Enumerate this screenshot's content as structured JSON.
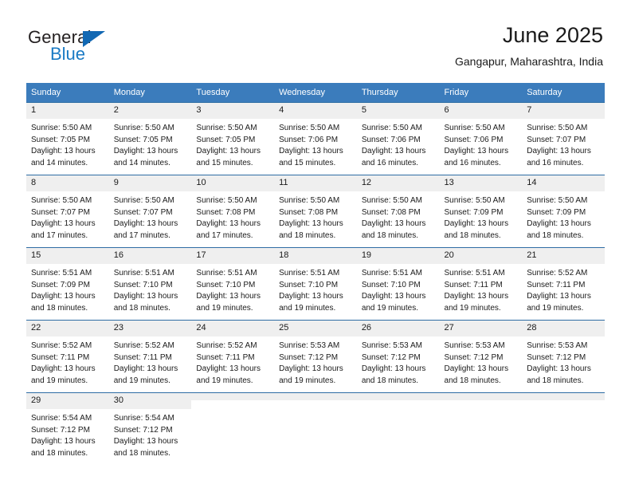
{
  "logo": {
    "primary_text": "General",
    "secondary_text": "Blue",
    "triangle_color": "#1268b3",
    "secondary_color": "#1a7ac4"
  },
  "header": {
    "title": "June 2025",
    "subtitle": "Gangapur, Maharashtra, India"
  },
  "theme": {
    "header_bg": "#3b7cbc",
    "row_divider": "#2e6da4",
    "daynum_bg": "#efefef",
    "text": "#1a1a1a"
  },
  "calendar": {
    "weekday_headers": [
      "Sunday",
      "Monday",
      "Tuesday",
      "Wednesday",
      "Thursday",
      "Friday",
      "Saturday"
    ],
    "weeks": [
      [
        {
          "day": "1",
          "sunrise": "Sunrise: 5:50 AM",
          "sunset": "Sunset: 7:05 PM",
          "daylight": "Daylight: 13 hours and 14 minutes."
        },
        {
          "day": "2",
          "sunrise": "Sunrise: 5:50 AM",
          "sunset": "Sunset: 7:05 PM",
          "daylight": "Daylight: 13 hours and 14 minutes."
        },
        {
          "day": "3",
          "sunrise": "Sunrise: 5:50 AM",
          "sunset": "Sunset: 7:05 PM",
          "daylight": "Daylight: 13 hours and 15 minutes."
        },
        {
          "day": "4",
          "sunrise": "Sunrise: 5:50 AM",
          "sunset": "Sunset: 7:06 PM",
          "daylight": "Daylight: 13 hours and 15 minutes."
        },
        {
          "day": "5",
          "sunrise": "Sunrise: 5:50 AM",
          "sunset": "Sunset: 7:06 PM",
          "daylight": "Daylight: 13 hours and 16 minutes."
        },
        {
          "day": "6",
          "sunrise": "Sunrise: 5:50 AM",
          "sunset": "Sunset: 7:06 PM",
          "daylight": "Daylight: 13 hours and 16 minutes."
        },
        {
          "day": "7",
          "sunrise": "Sunrise: 5:50 AM",
          "sunset": "Sunset: 7:07 PM",
          "daylight": "Daylight: 13 hours and 16 minutes."
        }
      ],
      [
        {
          "day": "8",
          "sunrise": "Sunrise: 5:50 AM",
          "sunset": "Sunset: 7:07 PM",
          "daylight": "Daylight: 13 hours and 17 minutes."
        },
        {
          "day": "9",
          "sunrise": "Sunrise: 5:50 AM",
          "sunset": "Sunset: 7:07 PM",
          "daylight": "Daylight: 13 hours and 17 minutes."
        },
        {
          "day": "10",
          "sunrise": "Sunrise: 5:50 AM",
          "sunset": "Sunset: 7:08 PM",
          "daylight": "Daylight: 13 hours and 17 minutes."
        },
        {
          "day": "11",
          "sunrise": "Sunrise: 5:50 AM",
          "sunset": "Sunset: 7:08 PM",
          "daylight": "Daylight: 13 hours and 18 minutes."
        },
        {
          "day": "12",
          "sunrise": "Sunrise: 5:50 AM",
          "sunset": "Sunset: 7:08 PM",
          "daylight": "Daylight: 13 hours and 18 minutes."
        },
        {
          "day": "13",
          "sunrise": "Sunrise: 5:50 AM",
          "sunset": "Sunset: 7:09 PM",
          "daylight": "Daylight: 13 hours and 18 minutes."
        },
        {
          "day": "14",
          "sunrise": "Sunrise: 5:50 AM",
          "sunset": "Sunset: 7:09 PM",
          "daylight": "Daylight: 13 hours and 18 minutes."
        }
      ],
      [
        {
          "day": "15",
          "sunrise": "Sunrise: 5:51 AM",
          "sunset": "Sunset: 7:09 PM",
          "daylight": "Daylight: 13 hours and 18 minutes."
        },
        {
          "day": "16",
          "sunrise": "Sunrise: 5:51 AM",
          "sunset": "Sunset: 7:10 PM",
          "daylight": "Daylight: 13 hours and 18 minutes."
        },
        {
          "day": "17",
          "sunrise": "Sunrise: 5:51 AM",
          "sunset": "Sunset: 7:10 PM",
          "daylight": "Daylight: 13 hours and 19 minutes."
        },
        {
          "day": "18",
          "sunrise": "Sunrise: 5:51 AM",
          "sunset": "Sunset: 7:10 PM",
          "daylight": "Daylight: 13 hours and 19 minutes."
        },
        {
          "day": "19",
          "sunrise": "Sunrise: 5:51 AM",
          "sunset": "Sunset: 7:10 PM",
          "daylight": "Daylight: 13 hours and 19 minutes."
        },
        {
          "day": "20",
          "sunrise": "Sunrise: 5:51 AM",
          "sunset": "Sunset: 7:11 PM",
          "daylight": "Daylight: 13 hours and 19 minutes."
        },
        {
          "day": "21",
          "sunrise": "Sunrise: 5:52 AM",
          "sunset": "Sunset: 7:11 PM",
          "daylight": "Daylight: 13 hours and 19 minutes."
        }
      ],
      [
        {
          "day": "22",
          "sunrise": "Sunrise: 5:52 AM",
          "sunset": "Sunset: 7:11 PM",
          "daylight": "Daylight: 13 hours and 19 minutes."
        },
        {
          "day": "23",
          "sunrise": "Sunrise: 5:52 AM",
          "sunset": "Sunset: 7:11 PM",
          "daylight": "Daylight: 13 hours and 19 minutes."
        },
        {
          "day": "24",
          "sunrise": "Sunrise: 5:52 AM",
          "sunset": "Sunset: 7:11 PM",
          "daylight": "Daylight: 13 hours and 19 minutes."
        },
        {
          "day": "25",
          "sunrise": "Sunrise: 5:53 AM",
          "sunset": "Sunset: 7:12 PM",
          "daylight": "Daylight: 13 hours and 19 minutes."
        },
        {
          "day": "26",
          "sunrise": "Sunrise: 5:53 AM",
          "sunset": "Sunset: 7:12 PM",
          "daylight": "Daylight: 13 hours and 18 minutes."
        },
        {
          "day": "27",
          "sunrise": "Sunrise: 5:53 AM",
          "sunset": "Sunset: 7:12 PM",
          "daylight": "Daylight: 13 hours and 18 minutes."
        },
        {
          "day": "28",
          "sunrise": "Sunrise: 5:53 AM",
          "sunset": "Sunset: 7:12 PM",
          "daylight": "Daylight: 13 hours and 18 minutes."
        }
      ],
      [
        {
          "day": "29",
          "sunrise": "Sunrise: 5:54 AM",
          "sunset": "Sunset: 7:12 PM",
          "daylight": "Daylight: 13 hours and 18 minutes."
        },
        {
          "day": "30",
          "sunrise": "Sunrise: 5:54 AM",
          "sunset": "Sunset: 7:12 PM",
          "daylight": "Daylight: 13 hours and 18 minutes."
        },
        {
          "day": "",
          "sunrise": "",
          "sunset": "",
          "daylight": ""
        },
        {
          "day": "",
          "sunrise": "",
          "sunset": "",
          "daylight": ""
        },
        {
          "day": "",
          "sunrise": "",
          "sunset": "",
          "daylight": ""
        },
        {
          "day": "",
          "sunrise": "",
          "sunset": "",
          "daylight": ""
        },
        {
          "day": "",
          "sunrise": "",
          "sunset": "",
          "daylight": ""
        }
      ]
    ]
  }
}
